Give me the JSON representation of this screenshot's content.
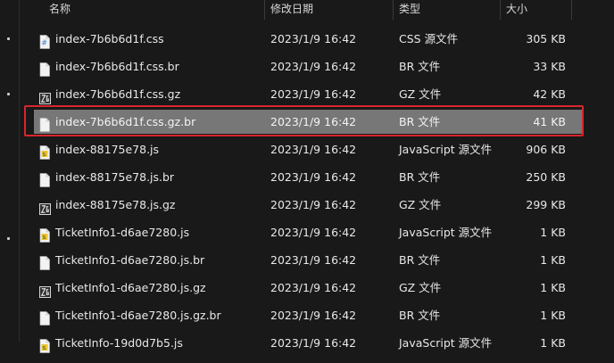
{
  "header": {
    "name": "名称",
    "modified": "修改日期",
    "type": "类型",
    "size": "大小"
  },
  "files": [
    {
      "name": "index-7b6b6d1f.css",
      "modified": "2023/1/9 16:42",
      "type": "CSS 源文件",
      "size": "305 KB",
      "icon": "css-file-icon"
    },
    {
      "name": "index-7b6b6d1f.css.br",
      "modified": "2023/1/9 16:42",
      "type": "BR 文件",
      "size": "33 KB",
      "icon": "blank-file-icon"
    },
    {
      "name": "index-7b6b6d1f.css.gz",
      "modified": "2023/1/9 16:42",
      "type": "GZ 文件",
      "size": "42 KB",
      "icon": "archive-file-icon"
    },
    {
      "name": "index-7b6b6d1f.css.gz.br",
      "modified": "2023/1/9 16:42",
      "type": "BR 文件",
      "size": "41 KB",
      "icon": "blank-file-icon",
      "selected": true
    },
    {
      "name": "index-88175e78.js",
      "modified": "2023/1/9 16:42",
      "type": "JavaScript 源文件",
      "size": "906 KB",
      "icon": "js-file-icon"
    },
    {
      "name": "index-88175e78.js.br",
      "modified": "2023/1/9 16:42",
      "type": "BR 文件",
      "size": "250 KB",
      "icon": "blank-file-icon"
    },
    {
      "name": "index-88175e78.js.gz",
      "modified": "2023/1/9 16:42",
      "type": "GZ 文件",
      "size": "299 KB",
      "icon": "archive-file-icon"
    },
    {
      "name": "TicketInfo1-d6ae7280.js",
      "modified": "2023/1/9 16:42",
      "type": "JavaScript 源文件",
      "size": "1 KB",
      "icon": "js-file-icon"
    },
    {
      "name": "TicketInfo1-d6ae7280.js.br",
      "modified": "2023/1/9 16:42",
      "type": "BR 文件",
      "size": "1 KB",
      "icon": "blank-file-icon"
    },
    {
      "name": "TicketInfo1-d6ae7280.js.gz",
      "modified": "2023/1/9 16:42",
      "type": "GZ 文件",
      "size": "1 KB",
      "icon": "archive-file-icon"
    },
    {
      "name": "TicketInfo1-d6ae7280.js.gz.br",
      "modified": "2023/1/9 16:42",
      "type": "BR 文件",
      "size": "1 KB",
      "icon": "blank-file-icon"
    },
    {
      "name": "TicketInfo-19d0d7b5.js",
      "modified": "2023/1/9 16:42",
      "type": "JavaScript 源文件",
      "size": "1 KB",
      "icon": "js-file-icon"
    }
  ],
  "colors": {
    "background": "#191919",
    "selection": "#777777",
    "highlight_outline": "#d7262e",
    "css_icon_accent": "#3b7bd0",
    "js_icon_accent": "#e6c532"
  }
}
